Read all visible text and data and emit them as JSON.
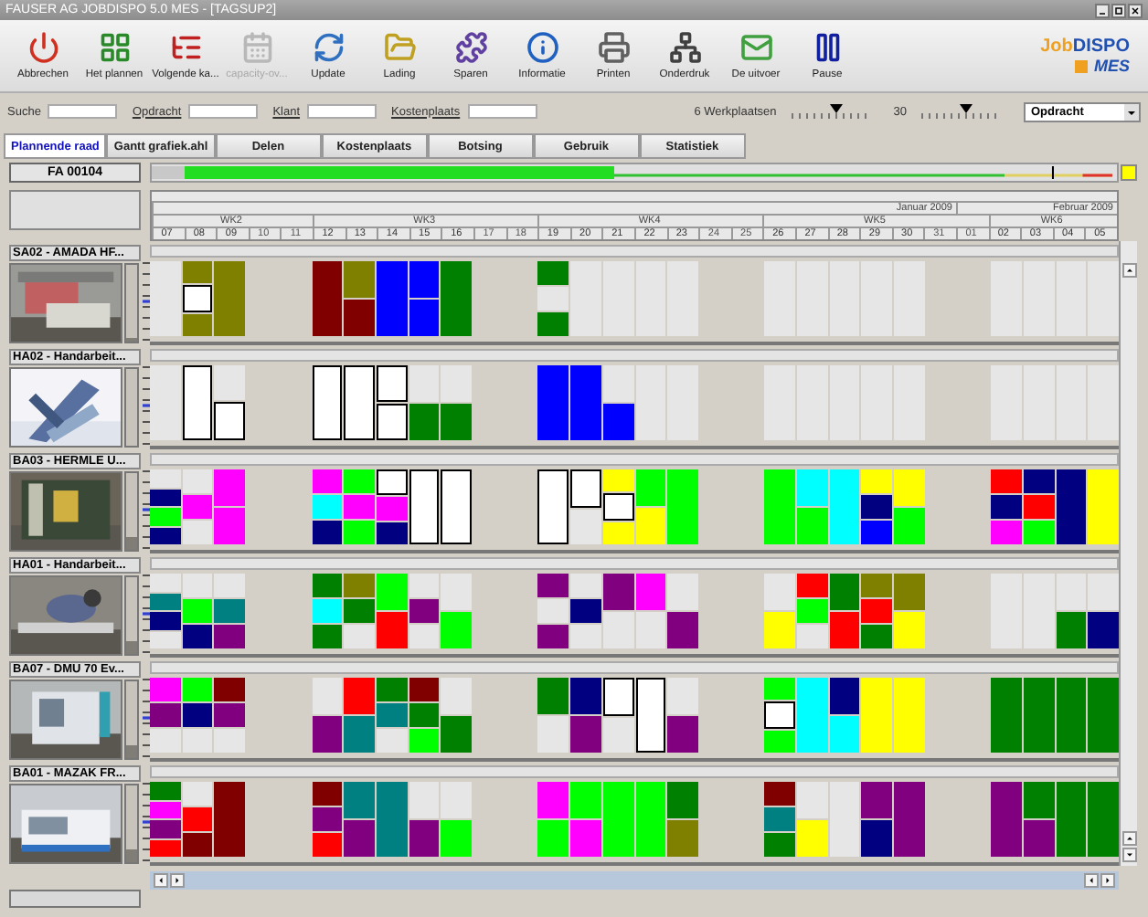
{
  "window": {
    "title": "FAUSER AG JOBDISPO 5.0 MES - [TAGSUP2]"
  },
  "toolbar": [
    {
      "label": "Abbrechen",
      "disabled": false
    },
    {
      "label": "Het plannen",
      "disabled": false
    },
    {
      "label": "Volgende ka...",
      "disabled": false
    },
    {
      "label": "capacity-ov...",
      "disabled": true
    },
    {
      "label": "Update",
      "disabled": false
    },
    {
      "label": "Lading",
      "disabled": false
    },
    {
      "label": "Sparen",
      "disabled": false
    },
    {
      "label": "Informatie",
      "disabled": false
    },
    {
      "label": "Printen",
      "disabled": false
    },
    {
      "label": "Onderdruk",
      "disabled": false
    },
    {
      "label": "De uitvoer",
      "disabled": false
    },
    {
      "label": "Pause",
      "disabled": false
    }
  ],
  "logo": {
    "first": "Job",
    "second": "DISPO",
    "sub": "MES"
  },
  "filters": [
    {
      "label": "Suche",
      "kind": "plain"
    },
    {
      "label": "Opdracht",
      "kind": "link"
    },
    {
      "label": "Klant",
      "kind": "link"
    },
    {
      "label": "Kostenplaats",
      "kind": "link"
    }
  ],
  "sliders": [
    {
      "label": "6 Werkplaatsen",
      "level": 0.55
    },
    {
      "label": "30",
      "level": 0.55
    }
  ],
  "select": {
    "value": "Opdracht"
  },
  "tabs": [
    {
      "label": "Plannende raad",
      "selected": true
    },
    {
      "label": "Gantt grafiek.ahl",
      "selected": false
    },
    {
      "label": "Delen",
      "selected": false
    },
    {
      "label": "Kostenplaats",
      "selected": false
    },
    {
      "label": "Botsing",
      "selected": false
    },
    {
      "label": "Gebruik",
      "selected": false
    },
    {
      "label": "Statistiek",
      "selected": false
    }
  ],
  "order": {
    "label": "FA 00104",
    "level": 0.48
  },
  "months": [
    "Januar 2009",
    "Februar 2009"
  ],
  "weeks": [
    "WK2",
    "WK3",
    "WK4",
    "WK5",
    "WK6"
  ],
  "days": [
    {
      "label": "07",
      "weekend": false
    },
    {
      "label": "08",
      "weekend": false
    },
    {
      "label": "09",
      "weekend": false
    },
    {
      "label": "10",
      "weekend": true
    },
    {
      "label": "11",
      "weekend": true
    },
    {
      "label": "12",
      "weekend": false
    },
    {
      "label": "13",
      "weekend": false
    },
    {
      "label": "14",
      "weekend": false
    },
    {
      "label": "15",
      "weekend": false
    },
    {
      "label": "16",
      "weekend": false
    },
    {
      "label": "17",
      "weekend": true
    },
    {
      "label": "18",
      "weekend": true
    },
    {
      "label": "19",
      "weekend": false
    },
    {
      "label": "20",
      "weekend": false
    },
    {
      "label": "21",
      "weekend": false
    },
    {
      "label": "22",
      "weekend": false
    },
    {
      "label": "23",
      "weekend": false
    },
    {
      "label": "24",
      "weekend": true
    },
    {
      "label": "25",
      "weekend": true
    },
    {
      "label": "26",
      "weekend": false
    },
    {
      "label": "27",
      "weekend": false
    },
    {
      "label": "28",
      "weekend": false
    },
    {
      "label": "29",
      "weekend": false
    },
    {
      "label": "30",
      "weekend": false
    },
    {
      "label": "31",
      "weekend": true
    },
    {
      "label": "01",
      "weekend": true
    },
    {
      "label": "02",
      "weekend": false
    },
    {
      "label": "03",
      "weekend": false
    },
    {
      "label": "04",
      "weekend": false
    },
    {
      "label": "05",
      "weekend": false
    }
  ],
  "machines": [
    {
      "name": "SA02 - AMADA HF...",
      "level": 0.04,
      "cells": [
        [
          {
            "kind": "bar",
            "color": "#e6e6e6"
          }
        ],
        [
          {
            "kind": "bar",
            "color": "#808000"
          },
          {
            "kind": "box",
            "color": "#ffffff"
          },
          {
            "kind": "bar",
            "color": "#808000"
          }
        ],
        [
          {
            "kind": "bar",
            "color": "#808000"
          }
        ],
        [
          {
            "kind": "bar",
            "color": "#800000"
          }
        ],
        [
          {
            "kind": "bar",
            "color": "#808000"
          },
          {
            "kind": "bar",
            "color": "#800000"
          }
        ],
        [
          {
            "kind": "bar",
            "color": "#0000ff"
          }
        ],
        [
          {
            "kind": "bar",
            "color": "#0000ff"
          },
          {
            "kind": "bar",
            "color": "#0000ff"
          }
        ],
        [
          {
            "kind": "bar",
            "color": "#008000"
          }
        ],
        [
          {
            "kind": "bar",
            "color": "#008000"
          },
          {
            "kind": "bar",
            "color": "#e6e6e6"
          },
          {
            "kind": "bar",
            "color": "#008000"
          }
        ],
        [
          {
            "kind": "bar",
            "color": "#e6e6e6"
          }
        ],
        [
          {
            "kind": "bar",
            "color": "#e6e6e6"
          }
        ],
        [
          {
            "kind": "bar",
            "color": "#e6e6e6"
          }
        ],
        [
          {
            "kind": "bar",
            "color": "#e6e6e6"
          }
        ],
        [
          {
            "kind": "bar",
            "color": "#e6e6e6"
          }
        ],
        [
          {
            "kind": "bar",
            "color": "#e6e6e6"
          }
        ],
        [
          {
            "kind": "bar",
            "color": "#e6e6e6"
          }
        ],
        [
          {
            "kind": "bar",
            "color": "#e6e6e6"
          }
        ],
        [
          {
            "kind": "bar",
            "color": "#e6e6e6"
          }
        ],
        [
          {
            "kind": "bar",
            "color": "#e6e6e6"
          }
        ],
        [
          {
            "kind": "bar",
            "color": "#e6e6e6"
          }
        ],
        [
          {
            "kind": "bar",
            "color": "#e6e6e6"
          }
        ],
        [
          {
            "kind": "bar",
            "color": "#e6e6e6"
          }
        ]
      ]
    },
    {
      "name": "HA02 - Handarbeit...",
      "level": 0.0,
      "cells": [
        [
          {
            "kind": "bar",
            "color": "#e6e6e6"
          }
        ],
        [
          {
            "kind": "box",
            "color": "#ffffff"
          }
        ],
        [
          {
            "kind": "bar",
            "color": "#e6e6e6"
          },
          {
            "kind": "box",
            "color": "#ffffff"
          }
        ],
        [
          {
            "kind": "box",
            "color": "#ffffff"
          }
        ],
        [
          {
            "kind": "box",
            "color": "#ffffff"
          }
        ],
        [
          {
            "kind": "box",
            "color": "#ffffff"
          },
          {
            "kind": "box",
            "color": "#ffffff"
          }
        ],
        [
          {
            "kind": "bar",
            "color": "#e6e6e6"
          },
          {
            "kind": "bar",
            "color": "#008000"
          }
        ],
        [
          {
            "kind": "bar",
            "color": "#e6e6e6"
          },
          {
            "kind": "bar",
            "color": "#008000"
          }
        ],
        [
          {
            "kind": "bar",
            "color": "#0000ff"
          }
        ],
        [
          {
            "kind": "bar",
            "color": "#0000ff"
          }
        ],
        [
          {
            "kind": "bar",
            "color": "#e6e6e6"
          },
          {
            "kind": "bar",
            "color": "#0000ff"
          }
        ],
        [
          {
            "kind": "bar",
            "color": "#e6e6e6"
          }
        ],
        [
          {
            "kind": "bar",
            "color": "#e6e6e6"
          }
        ],
        [
          {
            "kind": "bar",
            "color": "#e6e6e6"
          }
        ],
        [
          {
            "kind": "bar",
            "color": "#e6e6e6"
          }
        ],
        [
          {
            "kind": "bar",
            "color": "#e6e6e6"
          }
        ],
        [
          {
            "kind": "bar",
            "color": "#e6e6e6"
          }
        ],
        [
          {
            "kind": "bar",
            "color": "#e6e6e6"
          }
        ],
        [
          {
            "kind": "bar",
            "color": "#e6e6e6"
          }
        ],
        [
          {
            "kind": "bar",
            "color": "#e6e6e6"
          }
        ],
        [
          {
            "kind": "bar",
            "color": "#e6e6e6"
          }
        ],
        [
          {
            "kind": "bar",
            "color": "#e6e6e6"
          }
        ]
      ]
    },
    {
      "name": "BA03 - HERMLE U...",
      "level": 0.16,
      "cells": [
        [
          {
            "kind": "bar",
            "color": "#e6e6e6"
          },
          {
            "kind": "bar",
            "color": "#000080"
          },
          {
            "kind": "bar",
            "color": "#00ff00"
          },
          {
            "kind": "bar",
            "color": "#000080"
          }
        ],
        [
          {
            "kind": "bar",
            "color": "#e6e6e6"
          },
          {
            "kind": "bar",
            "color": "#ff00ff"
          },
          {
            "kind": "bar",
            "color": "#e6e6e6"
          }
        ],
        [
          {
            "kind": "bar",
            "color": "#ff00ff"
          },
          {
            "kind": "bar",
            "color": "#ff00ff"
          }
        ],
        [
          {
            "kind": "bar",
            "color": "#ff00ff"
          },
          {
            "kind": "bar",
            "color": "#00ffff"
          },
          {
            "kind": "bar",
            "color": "#000080"
          }
        ],
        [
          {
            "kind": "bar",
            "color": "#00ff00"
          },
          {
            "kind": "bar",
            "color": "#ff00ff"
          },
          {
            "kind": "bar",
            "color": "#00ff00"
          }
        ],
        [
          {
            "kind": "box",
            "color": "#ffffff"
          },
          {
            "kind": "bar",
            "color": "#ff00ff"
          },
          {
            "kind": "bar",
            "color": "#000080"
          }
        ],
        [
          {
            "kind": "box",
            "color": "#ffffff"
          }
        ],
        [
          {
            "kind": "box",
            "color": "#ffffff"
          }
        ],
        [
          {
            "kind": "box",
            "color": "#ffffff"
          }
        ],
        [
          {
            "kind": "box",
            "color": "#ffffff"
          },
          {
            "kind": "bar",
            "color": "#e6e6e6"
          }
        ],
        [
          {
            "kind": "bar",
            "color": "#ffff00"
          },
          {
            "kind": "box",
            "color": "#ffffff"
          },
          {
            "kind": "bar",
            "color": "#ffff00"
          }
        ],
        [
          {
            "kind": "bar",
            "color": "#00ff00"
          },
          {
            "kind": "bar",
            "color": "#ffff00"
          }
        ],
        [
          {
            "kind": "bar",
            "color": "#00ff00"
          }
        ],
        [
          {
            "kind": "bar",
            "color": "#00ff00"
          }
        ],
        [
          {
            "kind": "bar",
            "color": "#00ffff"
          },
          {
            "kind": "bar",
            "color": "#00ff00"
          }
        ],
        [
          {
            "kind": "bar",
            "color": "#00ffff"
          }
        ],
        [
          {
            "kind": "bar",
            "color": "#ffff00"
          },
          {
            "kind": "bar",
            "color": "#000080"
          },
          {
            "kind": "bar",
            "color": "#0000ff"
          }
        ],
        [
          {
            "kind": "bar",
            "color": "#ffff00"
          },
          {
            "kind": "bar",
            "color": "#00ff00"
          }
        ],
        [
          {
            "kind": "bar",
            "color": "#ff0000"
          },
          {
            "kind": "bar",
            "color": "#000080"
          },
          {
            "kind": "bar",
            "color": "#ff00ff"
          }
        ],
        [
          {
            "kind": "bar",
            "color": "#000080"
          },
          {
            "kind": "bar",
            "color": "#ff0000"
          },
          {
            "kind": "bar",
            "color": "#00ff00"
          }
        ],
        [
          {
            "kind": "bar",
            "color": "#000080"
          }
        ],
        [
          {
            "kind": "bar",
            "color": "#ffff00"
          }
        ]
      ]
    },
    {
      "name": "HA01 - Handarbeit...",
      "level": 0.16,
      "cells": [
        [
          {
            "kind": "bar",
            "color": "#e6e6e6"
          },
          {
            "kind": "bar",
            "color": "#008080"
          },
          {
            "kind": "bar",
            "color": "#000080"
          },
          {
            "kind": "bar",
            "color": "#e6e6e6"
          }
        ],
        [
          {
            "kind": "bar",
            "color": "#e6e6e6"
          },
          {
            "kind": "bar",
            "color": "#00ff00"
          },
          {
            "kind": "bar",
            "color": "#000080"
          }
        ],
        [
          {
            "kind": "bar",
            "color": "#e6e6e6"
          },
          {
            "kind": "bar",
            "color": "#008080"
          },
          {
            "kind": "bar",
            "color": "#800080"
          }
        ],
        [
          {
            "kind": "bar",
            "color": "#008000"
          },
          {
            "kind": "bar",
            "color": "#00ffff"
          },
          {
            "kind": "bar",
            "color": "#008000"
          }
        ],
        [
          {
            "kind": "bar",
            "color": "#808000"
          },
          {
            "kind": "bar",
            "color": "#008000"
          },
          {
            "kind": "bar",
            "color": "#e6e6e6"
          }
        ],
        [
          {
            "kind": "bar",
            "color": "#00ff00"
          },
          {
            "kind": "bar",
            "color": "#ff0000"
          }
        ],
        [
          {
            "kind": "bar",
            "color": "#e6e6e6"
          },
          {
            "kind": "bar",
            "color": "#800080"
          },
          {
            "kind": "bar",
            "color": "#e6e6e6"
          }
        ],
        [
          {
            "kind": "bar",
            "color": "#e6e6e6"
          },
          {
            "kind": "bar",
            "color": "#00ff00"
          }
        ],
        [
          {
            "kind": "bar",
            "color": "#800080"
          },
          {
            "kind": "bar",
            "color": "#e6e6e6"
          },
          {
            "kind": "bar",
            "color": "#800080"
          }
        ],
        [
          {
            "kind": "bar",
            "color": "#e6e6e6"
          },
          {
            "kind": "bar",
            "color": "#000080"
          },
          {
            "kind": "bar",
            "color": "#e6e6e6"
          }
        ],
        [
          {
            "kind": "bar",
            "color": "#800080"
          },
          {
            "kind": "bar",
            "color": "#e6e6e6"
          }
        ],
        [
          {
            "kind": "bar",
            "color": "#ff00ff"
          },
          {
            "kind": "bar",
            "color": "#e6e6e6"
          }
        ],
        [
          {
            "kind": "bar",
            "color": "#e6e6e6"
          },
          {
            "kind": "bar",
            "color": "#800080"
          }
        ],
        [
          {
            "kind": "bar",
            "color": "#e6e6e6"
          },
          {
            "kind": "bar",
            "color": "#ffff00"
          }
        ],
        [
          {
            "kind": "bar",
            "color": "#ff0000"
          },
          {
            "kind": "bar",
            "color": "#00ff00"
          },
          {
            "kind": "bar",
            "color": "#e6e6e6"
          }
        ],
        [
          {
            "kind": "bar",
            "color": "#008000"
          },
          {
            "kind": "bar",
            "color": "#ff0000"
          }
        ],
        [
          {
            "kind": "bar",
            "color": "#808000"
          },
          {
            "kind": "bar",
            "color": "#ff0000"
          },
          {
            "kind": "bar",
            "color": "#008000"
          }
        ],
        [
          {
            "kind": "bar",
            "color": "#808000"
          },
          {
            "kind": "bar",
            "color": "#ffff00"
          }
        ],
        [
          {
            "kind": "bar",
            "color": "#e6e6e6"
          }
        ],
        [
          {
            "kind": "bar",
            "color": "#e6e6e6"
          }
        ],
        [
          {
            "kind": "bar",
            "color": "#e6e6e6"
          },
          {
            "kind": "bar",
            "color": "#008000"
          }
        ],
        [
          {
            "kind": "bar",
            "color": "#e6e6e6"
          },
          {
            "kind": "bar",
            "color": "#000080"
          }
        ]
      ]
    },
    {
      "name": "BA07 - DMU 70 Ev...",
      "level": 0.16,
      "cells": [
        [
          {
            "kind": "bar",
            "color": "#ff00ff"
          },
          {
            "kind": "bar",
            "color": "#800080"
          },
          {
            "kind": "bar",
            "color": "#e6e6e6"
          }
        ],
        [
          {
            "kind": "bar",
            "color": "#00ff00"
          },
          {
            "kind": "bar",
            "color": "#000080"
          },
          {
            "kind": "bar",
            "color": "#e6e6e6"
          }
        ],
        [
          {
            "kind": "bar",
            "color": "#800000"
          },
          {
            "kind": "bar",
            "color": "#800080"
          },
          {
            "kind": "bar",
            "color": "#e6e6e6"
          }
        ],
        [
          {
            "kind": "bar",
            "color": "#e6e6e6"
          },
          {
            "kind": "bar",
            "color": "#800080"
          }
        ],
        [
          {
            "kind": "bar",
            "color": "#ff0000"
          },
          {
            "kind": "bar",
            "color": "#008080"
          }
        ],
        [
          {
            "kind": "bar",
            "color": "#008000"
          },
          {
            "kind": "bar",
            "color": "#008080"
          },
          {
            "kind": "bar",
            "color": "#e6e6e6"
          }
        ],
        [
          {
            "kind": "bar",
            "color": "#800000"
          },
          {
            "kind": "bar",
            "color": "#008000"
          },
          {
            "kind": "bar",
            "color": "#00ff00"
          }
        ],
        [
          {
            "kind": "bar",
            "color": "#e6e6e6"
          },
          {
            "kind": "bar",
            "color": "#008000"
          }
        ],
        [
          {
            "kind": "bar",
            "color": "#008000"
          },
          {
            "kind": "bar",
            "color": "#e6e6e6"
          }
        ],
        [
          {
            "kind": "bar",
            "color": "#000080"
          },
          {
            "kind": "bar",
            "color": "#800080"
          }
        ],
        [
          {
            "kind": "box",
            "color": "#ffffff"
          },
          {
            "kind": "bar",
            "color": "#e6e6e6"
          }
        ],
        [
          {
            "kind": "box",
            "color": "#ffffff"
          }
        ],
        [
          {
            "kind": "bar",
            "color": "#e6e6e6"
          },
          {
            "kind": "bar",
            "color": "#800080"
          }
        ],
        [
          {
            "kind": "bar",
            "color": "#00ff00"
          },
          {
            "kind": "box",
            "color": "#ffffff"
          },
          {
            "kind": "bar",
            "color": "#00ff00"
          }
        ],
        [
          {
            "kind": "bar",
            "color": "#00ffff"
          }
        ],
        [
          {
            "kind": "bar",
            "color": "#000080"
          },
          {
            "kind": "bar",
            "color": "#00ffff"
          }
        ],
        [
          {
            "kind": "bar",
            "color": "#ffff00"
          }
        ],
        [
          {
            "kind": "bar",
            "color": "#ffff00"
          }
        ],
        [
          {
            "kind": "bar",
            "color": "#008000"
          }
        ],
        [
          {
            "kind": "bar",
            "color": "#008000"
          }
        ],
        [
          {
            "kind": "bar",
            "color": "#008000"
          }
        ],
        [
          {
            "kind": "bar",
            "color": "#008000"
          }
        ]
      ]
    },
    {
      "name": "BA01 - MAZAK FR...",
      "level": 0.16,
      "cells": [
        [
          {
            "kind": "bar",
            "color": "#008000"
          },
          {
            "kind": "bar",
            "color": "#ff00ff"
          },
          {
            "kind": "bar",
            "color": "#800080"
          },
          {
            "kind": "bar",
            "color": "#ff0000"
          }
        ],
        [
          {
            "kind": "bar",
            "color": "#e6e6e6"
          },
          {
            "kind": "bar",
            "color": "#ff0000"
          },
          {
            "kind": "bar",
            "color": "#800000"
          }
        ],
        [
          {
            "kind": "bar",
            "color": "#800000"
          }
        ],
        [
          {
            "kind": "bar",
            "color": "#800000"
          },
          {
            "kind": "bar",
            "color": "#800080"
          },
          {
            "kind": "bar",
            "color": "#ff0000"
          }
        ],
        [
          {
            "kind": "bar",
            "color": "#008080"
          },
          {
            "kind": "bar",
            "color": "#800080"
          }
        ],
        [
          {
            "kind": "bar",
            "color": "#008080"
          }
        ],
        [
          {
            "kind": "bar",
            "color": "#e6e6e6"
          },
          {
            "kind": "bar",
            "color": "#800080"
          }
        ],
        [
          {
            "kind": "bar",
            "color": "#e6e6e6"
          },
          {
            "kind": "bar",
            "color": "#00ff00"
          }
        ],
        [
          {
            "kind": "bar",
            "color": "#ff00ff"
          },
          {
            "kind": "bar",
            "color": "#00ff00"
          }
        ],
        [
          {
            "kind": "bar",
            "color": "#00ff00"
          },
          {
            "kind": "bar",
            "color": "#ff00ff"
          }
        ],
        [
          {
            "kind": "bar",
            "color": "#00ff00"
          }
        ],
        [
          {
            "kind": "bar",
            "color": "#00ff00"
          }
        ],
        [
          {
            "kind": "bar",
            "color": "#008000"
          },
          {
            "kind": "bar",
            "color": "#808000"
          }
        ],
        [
          {
            "kind": "bar",
            "color": "#800000"
          },
          {
            "kind": "bar",
            "color": "#008080"
          },
          {
            "kind": "bar",
            "color": "#008000"
          }
        ],
        [
          {
            "kind": "bar",
            "color": "#e6e6e6"
          },
          {
            "kind": "bar",
            "color": "#ffff00"
          }
        ],
        [
          {
            "kind": "bar",
            "color": "#e6e6e6"
          }
        ],
        [
          {
            "kind": "bar",
            "color": "#800080"
          },
          {
            "kind": "bar",
            "color": "#000080"
          }
        ],
        [
          {
            "kind": "bar",
            "color": "#800080"
          }
        ],
        [
          {
            "kind": "bar",
            "color": "#800080"
          }
        ],
        [
          {
            "kind": "bar",
            "color": "#008000"
          },
          {
            "kind": "bar",
            "color": "#800080"
          }
        ],
        [
          {
            "kind": "bar",
            "color": "#008000"
          }
        ],
        [
          {
            "kind": "bar",
            "color": "#008000"
          }
        ]
      ]
    }
  ]
}
